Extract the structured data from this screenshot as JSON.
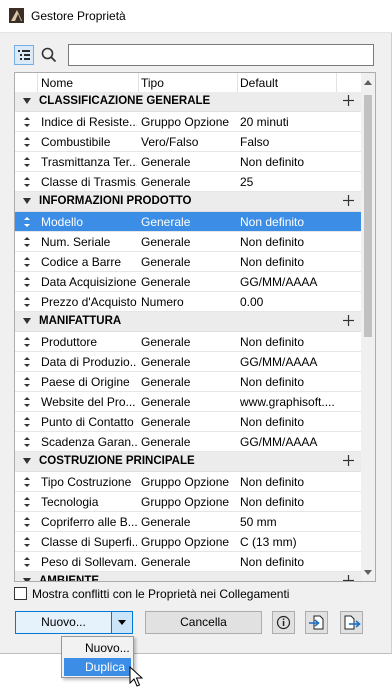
{
  "window": {
    "title": "Gestore Proprietà"
  },
  "toolbar": {
    "search_placeholder": ""
  },
  "table": {
    "headers": {
      "name": "Nome",
      "type": "Tipo",
      "default": "Default"
    },
    "groups": [
      {
        "title": "CLASSIFICAZIONE GENERALE",
        "rows": [
          {
            "name": "Indice di Resiste...",
            "type": "Gruppo Opzione",
            "default": "20 minuti"
          },
          {
            "name": "Combustibile",
            "type": "Vero/Falso",
            "default": "Falso"
          },
          {
            "name": "Trasmittanza Ter...",
            "type": "Generale",
            "default": "Non definito"
          },
          {
            "name": "Classe di Trasmis...",
            "type": "Generale",
            "default": "25"
          }
        ]
      },
      {
        "title": "INFORMAZIONI PRODOTTO",
        "rows": [
          {
            "name": "Modello",
            "type": "Generale",
            "default": "Non definito",
            "selected": true
          },
          {
            "name": "Num. Seriale",
            "type": "Generale",
            "default": "Non definito"
          },
          {
            "name": "Codice a Barre",
            "type": "Generale",
            "default": "Non definito"
          },
          {
            "name": "Data Acquisizione",
            "type": "Generale",
            "default": "GG/MM/AAAA"
          },
          {
            "name": "Prezzo d'Acquisto",
            "type": "Numero",
            "default": "0.00"
          }
        ]
      },
      {
        "title": "MANIFATTURA",
        "rows": [
          {
            "name": "Produttore",
            "type": "Generale",
            "default": "Non definito"
          },
          {
            "name": "Data di Produzio...",
            "type": "Generale",
            "default": "GG/MM/AAAA"
          },
          {
            "name": "Paese di Origine",
            "type": "Generale",
            "default": "Non definito"
          },
          {
            "name": "Website del Pro...",
            "type": "Generale",
            "default": "www.graphisoft...."
          },
          {
            "name": "Punto di Contatto",
            "type": "Generale",
            "default": "Non definito"
          },
          {
            "name": "Scadenza Garan...",
            "type": "Generale",
            "default": "GG/MM/AAAA"
          }
        ]
      },
      {
        "title": "COSTRUZIONE PRINCIPALE",
        "rows": [
          {
            "name": "Tipo Costruzione",
            "type": "Gruppo Opzione",
            "default": "Non definito"
          },
          {
            "name": "Tecnologia",
            "type": "Gruppo Opzione",
            "default": "Non definito"
          },
          {
            "name": "Copriferro alle B...",
            "type": "Generale",
            "default": "50 mm"
          },
          {
            "name": "Classe di Superfi...",
            "type": "Gruppo Opzione",
            "default": "C (13 mm)"
          },
          {
            "name": "Peso di Sollevam...",
            "type": "Generale",
            "default": "Non definito"
          }
        ]
      },
      {
        "title": "AMBIENTE",
        "rows": []
      }
    ]
  },
  "footer": {
    "checkbox_label": "Mostra conflitti con le Proprietà nei Collegamenti",
    "nuovo_label": "Nuovo...",
    "cancella_label": "Cancella"
  },
  "menu": {
    "items": [
      "Nuovo...",
      "Duplica"
    ],
    "highlighted": 1
  },
  "colors": {
    "selection": "#3c8de6",
    "group_bg": "#ececec",
    "dialog_bg": "#f0f0f0"
  }
}
